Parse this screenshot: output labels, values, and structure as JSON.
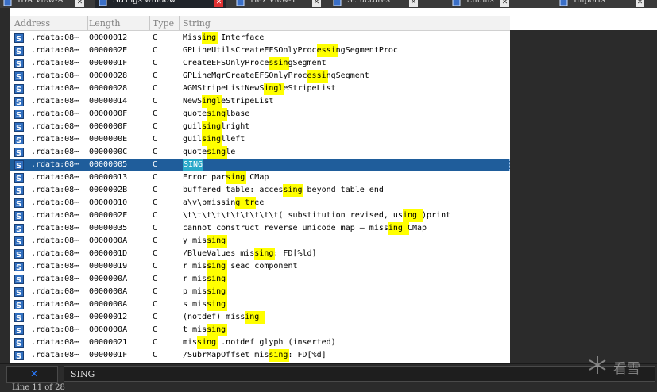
{
  "tabs": [
    {
      "label": "IDA View-A",
      "active": false,
      "icon": "ida-view-icon"
    },
    {
      "label": "Strings window",
      "active": true,
      "icon": "strings-icon"
    },
    {
      "label": "Hex View-1",
      "active": false,
      "icon": "hex-view-icon"
    },
    {
      "label": "Structures",
      "active": false,
      "icon": "structures-icon"
    },
    {
      "label": "Enums",
      "active": false,
      "icon": "enums-icon"
    },
    {
      "label": "Imports",
      "active": false,
      "icon": "imports-icon"
    }
  ],
  "columns": {
    "address": "Address",
    "length": "Length",
    "type": "Type",
    "string": "String"
  },
  "highlight_color": "#ffff00",
  "selection_color": "#1f5d9b",
  "rows": [
    {
      "address": ".rdata:08⋯",
      "length": "00000012",
      "type": "C",
      "string": "Missing Interface",
      "hl": [
        [
          4,
          3
        ]
      ]
    },
    {
      "address": ".rdata:08⋯",
      "length": "0000002E",
      "type": "C",
      "string": "GPLineUtilsCreateEFSOnlyProcessingSegmentProc",
      "hl": [
        [
          28,
          4
        ]
      ]
    },
    {
      "address": ".rdata:08⋯",
      "length": "0000001F",
      "type": "C",
      "string": "CreateEFSOnlyProcessingSegment",
      "hl": [
        [
          18,
          4
        ]
      ]
    },
    {
      "address": ".rdata:08⋯",
      "length": "00000028",
      "type": "C",
      "string": "GPLineMgrCreateEFSOnlyProcessingSegment",
      "hl": [
        [
          26,
          4
        ]
      ]
    },
    {
      "address": ".rdata:08⋯",
      "length": "00000028",
      "type": "C",
      "string": "AGMStripeListNewSingleStripeList",
      "hl": [
        [
          17,
          4
        ]
      ]
    },
    {
      "address": ".rdata:08⋯",
      "length": "00000014",
      "type": "C",
      "string": "NewSingleStripeList",
      "hl": [
        [
          4,
          4
        ]
      ]
    },
    {
      "address": ".rdata:08⋯",
      "length": "0000000F",
      "type": "C",
      "string": "quotesinglbase",
      "hl": [
        [
          5,
          4
        ]
      ]
    },
    {
      "address": ".rdata:08⋯",
      "length": "0000000F",
      "type": "C",
      "string": "guilsinglright",
      "hl": [
        [
          4,
          4
        ]
      ]
    },
    {
      "address": ".rdata:08⋯",
      "length": "0000000E",
      "type": "C",
      "string": "guilsinglleft",
      "hl": [
        [
          4,
          4
        ]
      ]
    },
    {
      "address": ".rdata:08⋯",
      "length": "0000000C",
      "type": "C",
      "string": "quotesingle",
      "hl": [
        [
          5,
          4
        ]
      ]
    },
    {
      "address": ".rdata:08⋯",
      "length": "00000005",
      "type": "C",
      "string": "SING",
      "hl": [],
      "selected": true
    },
    {
      "address": ".rdata:08⋯",
      "length": "00000013",
      "type": "C",
      "string": "Error parsing CMap",
      "hl": [
        [
          9,
          4
        ]
      ]
    },
    {
      "address": ".rdata:08⋯",
      "length": "0000002B",
      "type": "C",
      "string": "buffered table: accessing beyond table end",
      "hl": [
        [
          21,
          4
        ]
      ]
    },
    {
      "address": ".rdata:08⋯",
      "length": "00000010",
      "type": "C",
      "string": "a\\v\\bmissing tree",
      "hl": [
        [
          11,
          4
        ]
      ]
    },
    {
      "address": ".rdata:08⋯",
      "length": "0000002F",
      "type": "C",
      "string": "\\t\\t\\t\\t\\t\\t\\t\\t\\t\\t( substitution revised, using )print",
      "hl": [
        [
          46,
          4
        ]
      ]
    },
    {
      "address": ".rdata:08⋯",
      "length": "00000035",
      "type": "C",
      "string": "cannot construct reverse unicode map — missing CMap",
      "hl": [
        [
          43,
          4
        ]
      ]
    },
    {
      "address": ".rdata:08⋯",
      "length": "0000000A",
      "type": "C",
      "string": "y missing",
      "hl": [
        [
          5,
          4
        ]
      ]
    },
    {
      "address": ".rdata:08⋯",
      "length": "0000001D",
      "type": "C",
      "string": "/BlueValues missing: FD[%ld]",
      "hl": [
        [
          15,
          4
        ]
      ]
    },
    {
      "address": ".rdata:08⋯",
      "length": "00000019",
      "type": "C",
      "string": "r missing seac component",
      "hl": [
        [
          5,
          4
        ]
      ]
    },
    {
      "address": ".rdata:08⋯",
      "length": "0000000A",
      "type": "C",
      "string": "r missing",
      "hl": [
        [
          5,
          4
        ]
      ]
    },
    {
      "address": ".rdata:08⋯",
      "length": "0000000A",
      "type": "C",
      "string": "p missing",
      "hl": [
        [
          5,
          4
        ]
      ]
    },
    {
      "address": ".rdata:08⋯",
      "length": "0000000A",
      "type": "C",
      "string": "s missing",
      "hl": [
        [
          5,
          4
        ]
      ]
    },
    {
      "address": ".rdata:08⋯",
      "length": "00000012",
      "type": "C",
      "string": " (notdef) missing",
      "hl": [
        [
          13,
          4
        ]
      ]
    },
    {
      "address": ".rdata:08⋯",
      "length": "0000000A",
      "type": "C",
      "string": "t missing",
      "hl": [
        [
          5,
          4
        ]
      ]
    },
    {
      "address": ".rdata:08⋯",
      "length": "00000021",
      "type": "C",
      "string": "missing .notdef glyph (inserted)",
      "hl": [
        [
          3,
          4
        ]
      ]
    },
    {
      "address": ".rdata:08⋯",
      "length": "0000001F",
      "type": "C",
      "string": "/SubrMapOffset missing: FD[%d]",
      "hl": [
        [
          18,
          4
        ]
      ]
    }
  ],
  "search": {
    "value": "SING",
    "clear_icon": "close-x-icon"
  },
  "status": "Line 11 of 28",
  "watermark": "看雪"
}
